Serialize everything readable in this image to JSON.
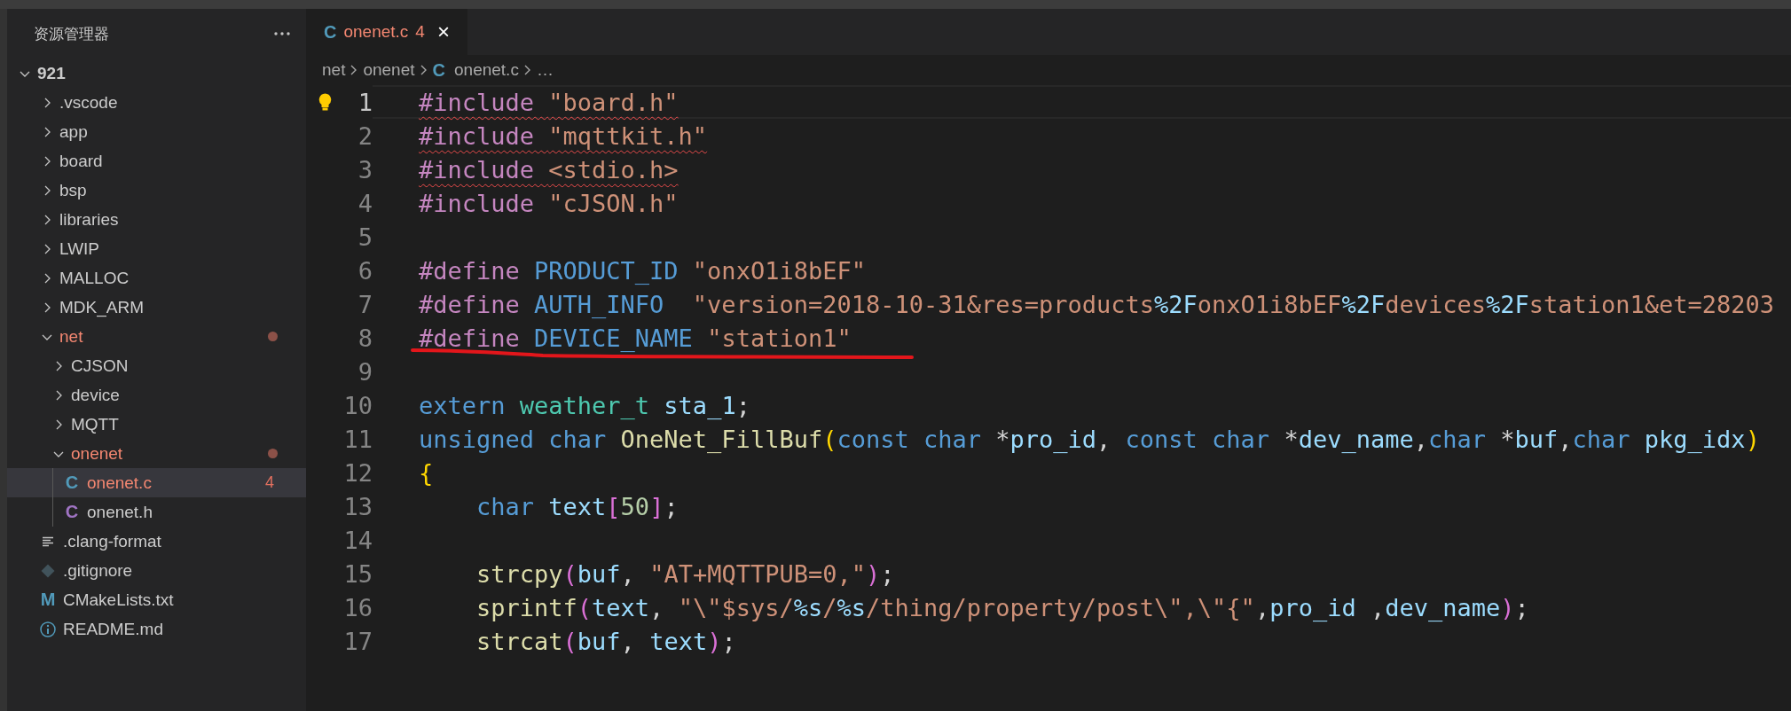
{
  "explorer": {
    "title": "资源管理器",
    "root": {
      "kind": "folder",
      "label": "921",
      "expanded": true,
      "modified": false,
      "selected": false,
      "children": [
        {
          "kind": "folder",
          "label": ".vscode",
          "expanded": false,
          "modified": false,
          "selected": false
        },
        {
          "kind": "folder",
          "label": "app",
          "expanded": false,
          "modified": false,
          "selected": false
        },
        {
          "kind": "folder",
          "label": "board",
          "expanded": false,
          "modified": false,
          "selected": false
        },
        {
          "kind": "folder",
          "label": "bsp",
          "expanded": false,
          "modified": false,
          "selected": false
        },
        {
          "kind": "folder",
          "label": "libraries",
          "expanded": false,
          "modified": false,
          "selected": false
        },
        {
          "kind": "folder",
          "label": "LWIP",
          "expanded": false,
          "modified": false,
          "selected": false
        },
        {
          "kind": "folder",
          "label": "MALLOC",
          "expanded": false,
          "modified": false,
          "selected": false
        },
        {
          "kind": "folder",
          "label": "MDK_ARM",
          "expanded": false,
          "modified": false,
          "selected": false
        },
        {
          "kind": "folder",
          "label": "net",
          "expanded": true,
          "modified": true,
          "selected": false,
          "children": [
            {
              "kind": "folder",
              "label": "CJSON",
              "expanded": false,
              "modified": false,
              "selected": false
            },
            {
              "kind": "folder",
              "label": "device",
              "expanded": false,
              "modified": false,
              "selected": false
            },
            {
              "kind": "folder",
              "label": "MQTT",
              "expanded": false,
              "modified": false,
              "selected": false
            },
            {
              "kind": "folder",
              "label": "onenet",
              "expanded": true,
              "modified": true,
              "selected": false,
              "children": [
                {
                  "kind": "c-source",
                  "glyph": "C",
                  "label": "onenet.c",
                  "badge": "4",
                  "modified": true,
                  "selected": true
                },
                {
                  "kind": "c-header",
                  "glyph": "C",
                  "label": "onenet.h",
                  "modified": false,
                  "selected": false
                }
              ]
            }
          ]
        },
        {
          "kind": "config",
          "label": ".clang-format",
          "modified": false,
          "selected": false
        },
        {
          "kind": "git",
          "label": ".gitignore",
          "modified": false,
          "selected": false
        },
        {
          "kind": "cmake",
          "glyph": "M",
          "label": "CMakeLists.txt",
          "modified": false,
          "selected": false
        },
        {
          "kind": "readme",
          "label": "README.md",
          "modified": false,
          "selected": false
        }
      ]
    }
  },
  "tabs": [
    {
      "glyph": "C",
      "label": "onenet.c",
      "count": "4",
      "close": "×",
      "modified": true,
      "selected": true
    }
  ],
  "breadcrumb": [
    {
      "label": "net"
    },
    {
      "label": "onenet"
    },
    {
      "glyph": "C",
      "label": "onenet.c"
    },
    {
      "label": "…"
    }
  ],
  "editor": {
    "lines": [
      {
        "number": "1",
        "current": true,
        "lightbulb": true,
        "squiggle": true,
        "tokens": [
          {
            "kind": "directive",
            "text": "#include "
          },
          {
            "kind": "string",
            "text": "\"board.h\""
          }
        ]
      },
      {
        "number": "2",
        "current": false,
        "squiggle": true,
        "tokens": [
          {
            "kind": "directive",
            "text": "#include "
          },
          {
            "kind": "string",
            "text": "\"mqttkit.h\""
          }
        ]
      },
      {
        "number": "3",
        "current": false,
        "squiggle": true,
        "tokens": [
          {
            "kind": "directive",
            "text": "#include "
          },
          {
            "kind": "string",
            "text": "<stdio.h>"
          }
        ]
      },
      {
        "number": "4",
        "current": false,
        "tokens": [
          {
            "kind": "directive",
            "text": "#include "
          },
          {
            "kind": "string",
            "text": "\"cJSON.h\""
          }
        ]
      },
      {
        "number": "5",
        "current": false
      },
      {
        "number": "6",
        "current": false,
        "tokens": [
          {
            "kind": "directive",
            "text": "#define "
          },
          {
            "kind": "macro",
            "text": "PRODUCT_ID "
          },
          {
            "kind": "string",
            "text": "\"onxO1i8bEF\""
          }
        ]
      },
      {
        "number": "7",
        "current": false,
        "tokens": [
          {
            "kind": "directive",
            "text": "#define "
          },
          {
            "kind": "macro",
            "text": "AUTH_INFO  "
          },
          {
            "kind": "string",
            "text": "\"version=2018-10-31&res=products"
          },
          {
            "kind": "format",
            "text": "%2F"
          },
          {
            "kind": "string",
            "text": "onxO1i8bEF"
          },
          {
            "kind": "format",
            "text": "%2F"
          },
          {
            "kind": "string",
            "text": "devices"
          },
          {
            "kind": "format",
            "text": "%2F"
          },
          {
            "kind": "string",
            "text": "station1&et=28203"
          }
        ]
      },
      {
        "number": "8",
        "current": false,
        "underlined": true,
        "tokens": [
          {
            "kind": "directive",
            "text": "#define "
          },
          {
            "kind": "macro",
            "text": "DEVICE_NAME "
          },
          {
            "kind": "string",
            "text": "\"station1\""
          }
        ]
      },
      {
        "number": "9",
        "current": false
      },
      {
        "number": "10",
        "current": false,
        "tokens": [
          {
            "kind": "keyword",
            "text": "extern "
          },
          {
            "kind": "type",
            "text": "weather_t "
          },
          {
            "kind": "variable",
            "text": "sta_1"
          },
          {
            "kind": "punct",
            "text": ";"
          }
        ]
      },
      {
        "number": "11",
        "current": false,
        "tokens": [
          {
            "kind": "keyword",
            "text": "unsigned char "
          },
          {
            "kind": "function",
            "text": "OneNet_FillBuf"
          },
          {
            "kind": "bracket1",
            "text": "("
          },
          {
            "kind": "keyword",
            "text": "const char "
          },
          {
            "kind": "punct",
            "text": "*"
          },
          {
            "kind": "variable",
            "text": "pro_id"
          },
          {
            "kind": "punct",
            "text": ", "
          },
          {
            "kind": "keyword",
            "text": "const char "
          },
          {
            "kind": "punct",
            "text": "*"
          },
          {
            "kind": "variable",
            "text": "dev_name"
          },
          {
            "kind": "punct",
            "text": ","
          },
          {
            "kind": "keyword",
            "text": "char "
          },
          {
            "kind": "punct",
            "text": "*"
          },
          {
            "kind": "variable",
            "text": "buf"
          },
          {
            "kind": "punct",
            "text": ","
          },
          {
            "kind": "keyword",
            "text": "char "
          },
          {
            "kind": "variable",
            "text": "pkg_idx"
          },
          {
            "kind": "bracket1",
            "text": ")"
          }
        ]
      },
      {
        "number": "12",
        "current": false,
        "tokens": [
          {
            "kind": "bracket1",
            "text": "{"
          }
        ]
      },
      {
        "number": "13",
        "current": false,
        "tokens": [
          {
            "kind": "keyword",
            "text": "    char "
          },
          {
            "kind": "variable",
            "text": "text"
          },
          {
            "kind": "bracket2",
            "text": "["
          },
          {
            "kind": "number",
            "text": "50"
          },
          {
            "kind": "bracket2",
            "text": "]"
          },
          {
            "kind": "punct",
            "text": ";"
          }
        ]
      },
      {
        "number": "14",
        "current": false
      },
      {
        "number": "15",
        "current": false,
        "tokens": [
          {
            "kind": "function",
            "text": "    strcpy"
          },
          {
            "kind": "bracket2",
            "text": "("
          },
          {
            "kind": "variable",
            "text": "buf"
          },
          {
            "kind": "punct",
            "text": ", "
          },
          {
            "kind": "string",
            "text": "\"AT+MQTTPUB=0,\""
          },
          {
            "kind": "bracket2",
            "text": ")"
          },
          {
            "kind": "punct",
            "text": ";"
          }
        ]
      },
      {
        "number": "16",
        "current": false,
        "tokens": [
          {
            "kind": "function",
            "text": "    sprintf"
          },
          {
            "kind": "bracket2",
            "text": "("
          },
          {
            "kind": "variable",
            "text": "text"
          },
          {
            "kind": "punct",
            "text": ", "
          },
          {
            "kind": "string",
            "text": "\"\\\"$sys/"
          },
          {
            "kind": "format",
            "text": "%s"
          },
          {
            "kind": "string",
            "text": "/"
          },
          {
            "kind": "format",
            "text": "%s"
          },
          {
            "kind": "string",
            "text": "/thing/property/post\\\",\\\"{\""
          },
          {
            "kind": "punct",
            "text": ","
          },
          {
            "kind": "variable",
            "text": "pro_id"
          },
          {
            "kind": "punct",
            "text": " ,"
          },
          {
            "kind": "variable",
            "text": "dev_name"
          },
          {
            "kind": "bracket2",
            "text": ")"
          },
          {
            "kind": "punct",
            "text": ";"
          }
        ]
      },
      {
        "number": "17",
        "current": false,
        "tokens": [
          {
            "kind": "function",
            "text": "    strcat"
          },
          {
            "kind": "bracket2",
            "text": "("
          },
          {
            "kind": "variable",
            "text": "buf"
          },
          {
            "kind": "punct",
            "text": ", "
          },
          {
            "kind": "variable",
            "text": "text"
          },
          {
            "kind": "bracket2",
            "text": ")"
          },
          {
            "kind": "punct",
            "text": ";"
          }
        ]
      }
    ]
  }
}
